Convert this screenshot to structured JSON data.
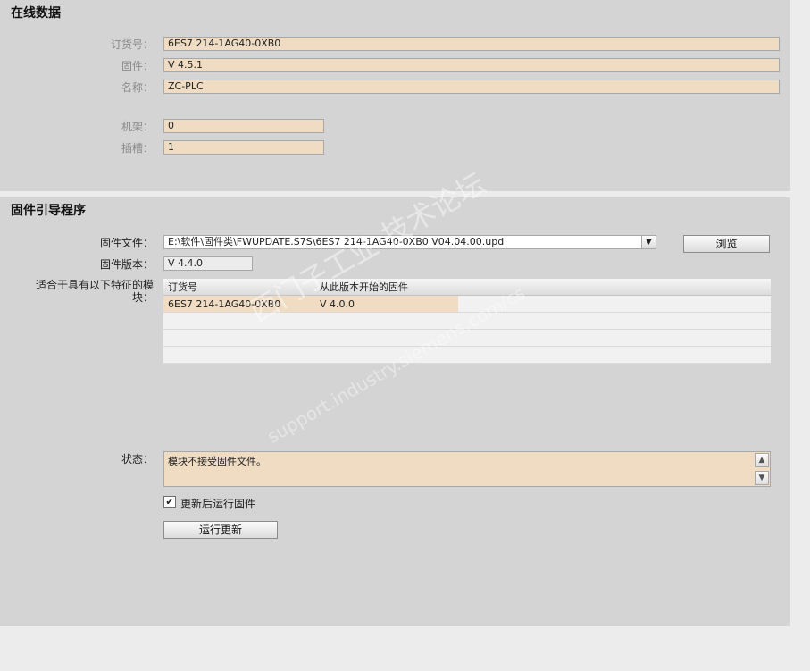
{
  "online_data": {
    "title": "在线数据",
    "order_no_label": "订货号：",
    "order_no": "6ES7 214-1AG40-0XB0",
    "firmware_label": "固件：",
    "firmware": "V 4.5.1",
    "name_label": "名称：",
    "name": "ZC-PLC",
    "rack_label": "机架：",
    "rack": "0",
    "slot_label": "插槽：",
    "slot": "1"
  },
  "loader": {
    "title": "固件引导程序",
    "file_label": "固件文件：",
    "file_path": "E:\\软件\\固件类\\FWUPDATE.S7S\\6ES7 214-1AG40-0XB0 V04.04.00.upd",
    "browse_label": "浏览",
    "version_label": "固件版本：",
    "version": "V 4.4.0",
    "compat_label": "适合于具有以下特征的模块：",
    "table": {
      "headers": [
        "订货号",
        "从此版本开始的固件"
      ],
      "rows": [
        [
          "6ES7 214-1AG40-0XB0",
          "V 4.0.0"
        ]
      ]
    },
    "status_label": "状态：",
    "status_text": "模块不接受固件文件。",
    "run_after_label": "更新后运行固件",
    "run_after_checked": true,
    "run_update_label": "运行更新"
  },
  "watermark": {
    "line1": "西门子工业 技术论坛",
    "line2": "support.industry.siemens.com/cs"
  },
  "colors": {
    "field_bg": "#efdcc3",
    "panel_bg": "#d4d4d4",
    "page_bg": "#ececec"
  }
}
